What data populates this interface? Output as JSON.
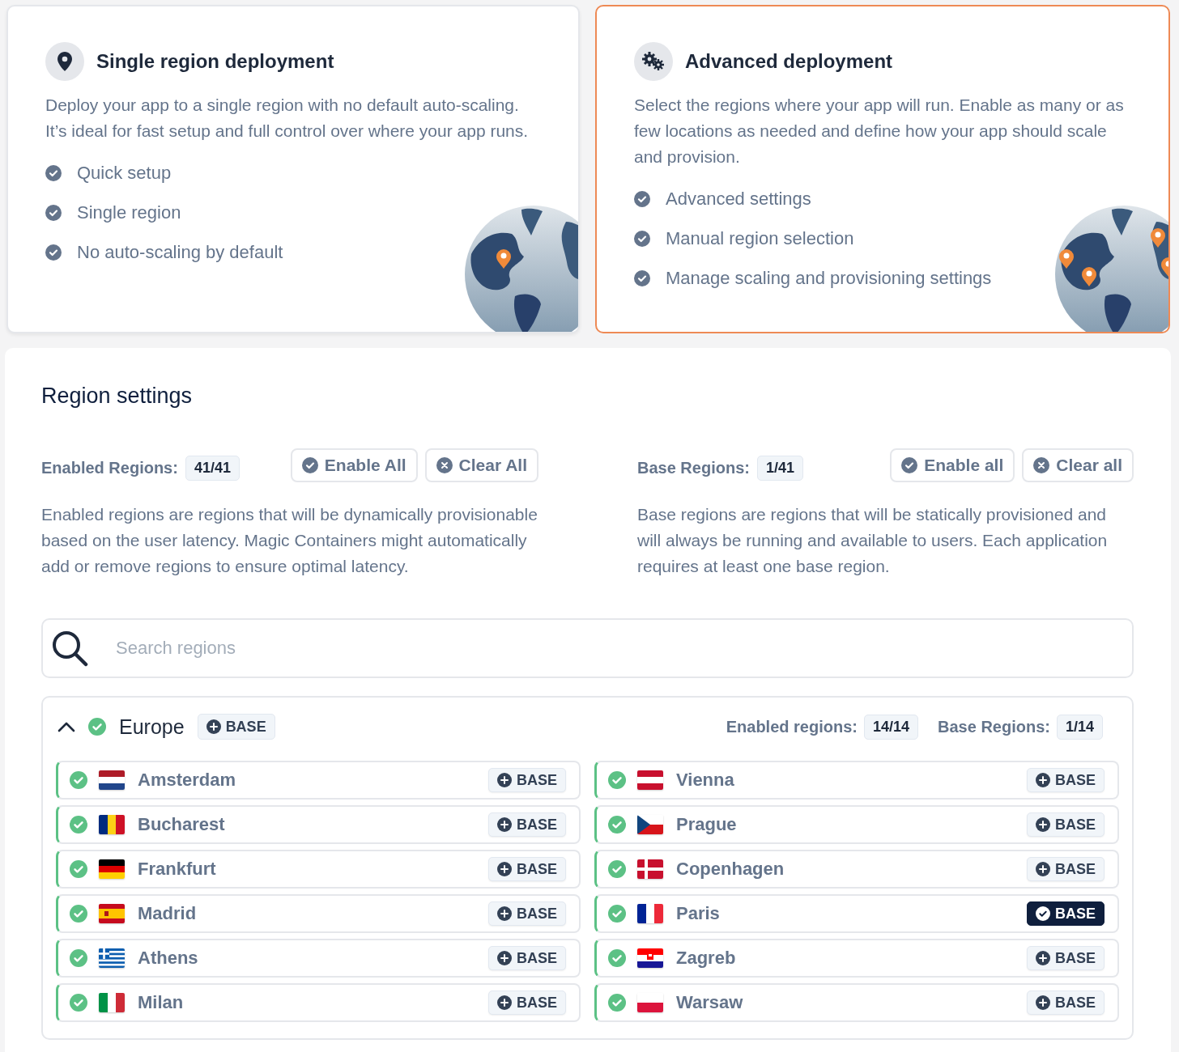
{
  "deployment_options": [
    {
      "kind": "single",
      "title": "Single region deployment",
      "description": "Deploy your app to a single region with no default auto-scaling. It’s ideal for fast setup and full control over where your app runs.",
      "features": [
        "Quick setup",
        "Single region",
        "No auto-scaling by default"
      ],
      "selected": false
    },
    {
      "kind": "advanced",
      "title": "Advanced deployment",
      "description": "Select the regions where your app will run. Enable as many or as few locations as needed and define how your app should scale and provision.",
      "features": [
        "Advanced settings",
        "Manual region selection",
        "Manage scaling and provisioning settings"
      ],
      "selected": true
    }
  ],
  "region_settings": {
    "title": "Region settings",
    "columns": [
      {
        "label": "Enabled Regions:",
        "count": "41/41",
        "buttons": [
          {
            "kind": "enable",
            "label": "Enable All"
          },
          {
            "kind": "clear",
            "label": "Clear All"
          }
        ],
        "description": "Enabled regions are regions that will be dynamically provisionable based on the user latency. Magic Containers might automatically add or remove regions to ensure optimal latency."
      },
      {
        "label": "Base Regions:",
        "count": "1/41",
        "buttons": [
          {
            "kind": "enable",
            "label": "Enable all"
          },
          {
            "kind": "clear",
            "label": "Clear all"
          }
        ],
        "description": "Base regions are regions that will be statically provisioned and will always be running and available to users. Each application requires at least one base region."
      }
    ],
    "search": {
      "placeholder": "Search regions"
    },
    "groups": [
      {
        "name": "Europe",
        "expanded": true,
        "enabled": true,
        "base_label": "BASE",
        "enabled_label": "Enabled regions:",
        "enabled_count": "14/14",
        "base_regions_label": "Base Regions:",
        "base_count": "1/14",
        "regions": [
          {
            "name": "Amsterdam",
            "kind": "nl",
            "enabled": true,
            "base": false,
            "base_label": "BASE"
          },
          {
            "name": "Vienna",
            "kind": "at",
            "enabled": true,
            "base": false,
            "base_label": "BASE"
          },
          {
            "name": "Bucharest",
            "kind": "ro",
            "enabled": true,
            "base": false,
            "base_label": "BASE"
          },
          {
            "name": "Prague",
            "kind": "cz",
            "enabled": true,
            "base": false,
            "base_label": "BASE"
          },
          {
            "name": "Frankfurt",
            "kind": "de",
            "enabled": true,
            "base": false,
            "base_label": "BASE"
          },
          {
            "name": "Copenhagen",
            "kind": "dk",
            "enabled": true,
            "base": false,
            "base_label": "BASE"
          },
          {
            "name": "Madrid",
            "kind": "es",
            "enabled": true,
            "base": false,
            "base_label": "BASE"
          },
          {
            "name": "Paris",
            "kind": "fr",
            "enabled": true,
            "base": true,
            "base_label": "BASE"
          },
          {
            "name": "Athens",
            "kind": "gr",
            "enabled": true,
            "base": false,
            "base_label": "BASE"
          },
          {
            "name": "Zagreb",
            "kind": "hr",
            "enabled": true,
            "base": false,
            "base_label": "BASE"
          },
          {
            "name": "Milan",
            "kind": "it",
            "enabled": true,
            "base": false,
            "base_label": "BASE"
          },
          {
            "name": "Warsaw",
            "kind": "pl",
            "enabled": true,
            "base": false,
            "base_label": "BASE"
          }
        ]
      }
    ]
  }
}
